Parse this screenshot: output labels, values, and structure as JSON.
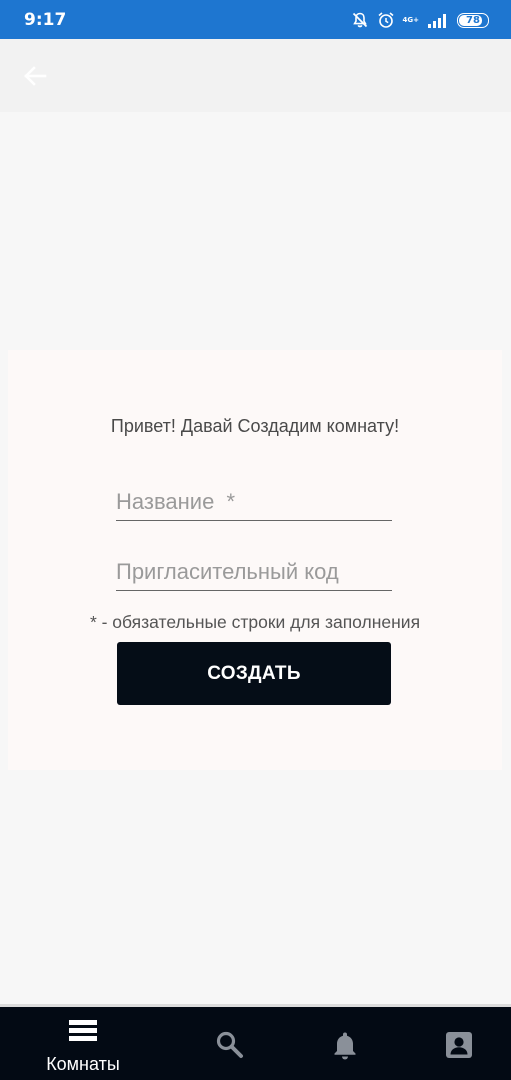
{
  "status_bar": {
    "time": "9:17",
    "network": "4G+",
    "battery_level": "78",
    "icons": [
      "notifications-off-icon",
      "alarm-icon",
      "signal-icon",
      "battery-icon"
    ]
  },
  "app_bar": {
    "back_icon": "arrow-left-icon"
  },
  "form": {
    "greeting": "Привет! Давай Создадим комнату!",
    "name_placeholder": "Название  *",
    "name_value": "",
    "invite_placeholder": "Пригласительный код",
    "invite_value": "",
    "required_hint": "* - обязательные строки для заполнения",
    "create_label": "СОЗДАТЬ"
  },
  "bottom_nav": {
    "items": [
      {
        "label": "Комнаты",
        "icon": "rooms-list-icon",
        "active": true
      },
      {
        "label": "",
        "icon": "search-icon",
        "active": false
      },
      {
        "label": "",
        "icon": "bell-icon",
        "active": false
      },
      {
        "label": "",
        "icon": "account-box-icon",
        "active": false
      }
    ]
  },
  "colors": {
    "status_bar": "#1e76d0",
    "app_bar": "#f2f2f2",
    "background": "#f7f7f7",
    "card": "#fdf9f8",
    "button": "#050d17",
    "bottom_nav": "#030a14"
  }
}
